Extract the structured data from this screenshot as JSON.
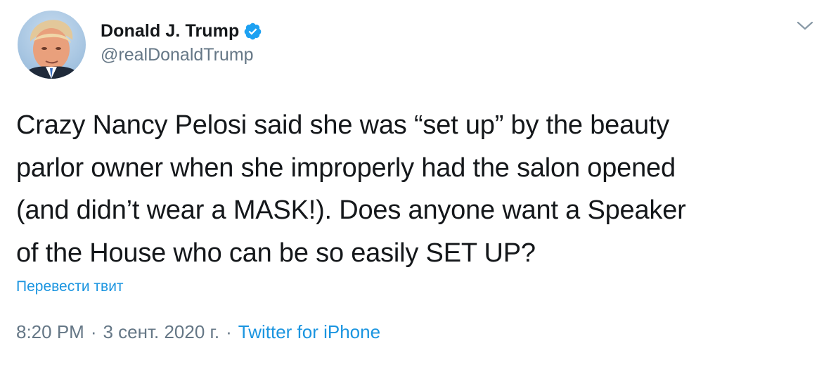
{
  "author": {
    "display_name": "Donald J. Trump",
    "handle": "@realDonaldTrump",
    "verified": true,
    "avatar_icon": "profile-photo"
  },
  "tweet": {
    "text": "Crazy Nancy Pelosi said she was “set up” by the beauty\nparlor owner when she improperly had the salon opened\n(and didn’t wear a MASK!). Does anyone want a Speaker\nof the House who can be so easily SET UP?",
    "translate_label": "Перевести твит",
    "time": "8:20 PM",
    "date": "3 сент. 2020 г.",
    "separator": "·",
    "source": "Twitter for iPhone"
  },
  "menu": {
    "icon": "chevron-down-icon"
  },
  "colors": {
    "text": "#14171a",
    "secondary": "#657786",
    "link": "#1b95e0",
    "verified": "#1da1f2"
  }
}
